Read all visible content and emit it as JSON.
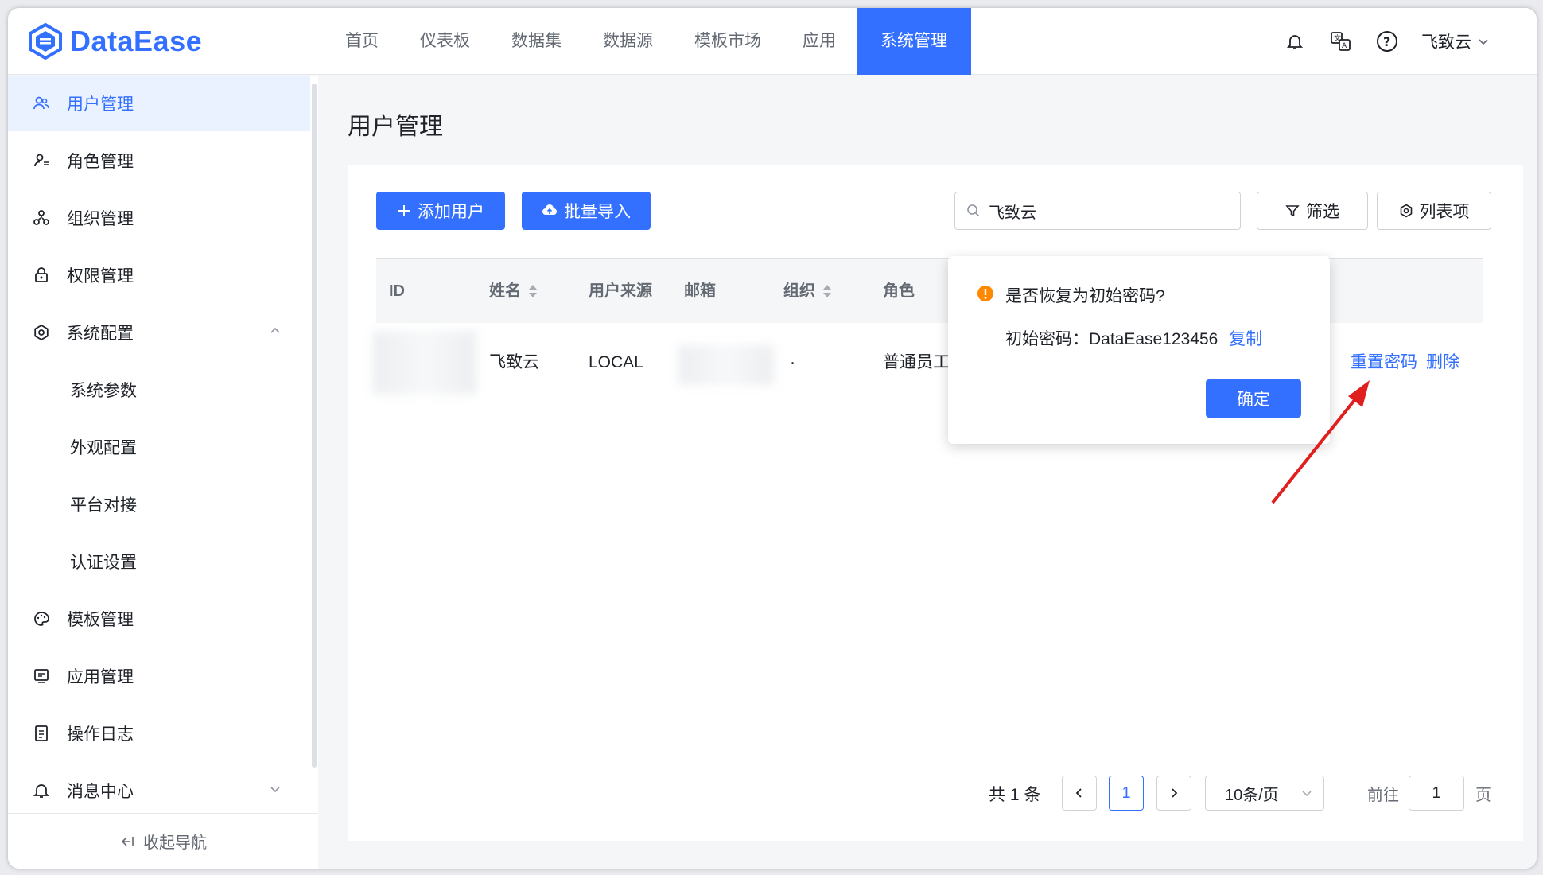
{
  "app": {
    "logo_text": "DataEase"
  },
  "nav": {
    "items": [
      "首页",
      "仪表板",
      "数据集",
      "数据源",
      "模板市场",
      "应用",
      "系统管理"
    ],
    "active_index": 6
  },
  "header": {
    "user_name": "飞致云"
  },
  "sidebar": {
    "items": [
      {
        "label": "用户管理",
        "icon": "users-icon"
      },
      {
        "label": "角色管理",
        "icon": "role-icon"
      },
      {
        "label": "组织管理",
        "icon": "org-icon"
      },
      {
        "label": "权限管理",
        "icon": "lock-icon"
      },
      {
        "label": "系统配置",
        "icon": "gear-icon"
      },
      {
        "label": "系统参数"
      },
      {
        "label": "外观配置"
      },
      {
        "label": "平台对接"
      },
      {
        "label": "认证设置"
      },
      {
        "label": "模板管理",
        "icon": "palette-icon"
      },
      {
        "label": "应用管理",
        "icon": "app-icon"
      },
      {
        "label": "操作日志",
        "icon": "log-icon"
      },
      {
        "label": "消息中心",
        "icon": "bell-icon"
      }
    ],
    "collapse_label": "收起导航"
  },
  "page": {
    "title": "用户管理"
  },
  "toolbar": {
    "add_user": "添加用户",
    "batch_import": "批量导入",
    "search_value": "飞致云",
    "filter": "筛选",
    "columns": "列表项"
  },
  "table": {
    "headers": [
      "ID",
      "姓名",
      "用户来源",
      "邮箱",
      "组织",
      "角色"
    ],
    "row": {
      "name": "飞致云",
      "source": "LOCAL",
      "org": "·",
      "role": "普通员工",
      "actions": {
        "reset": "重置密码",
        "delete": "删除"
      }
    }
  },
  "popconfirm": {
    "title": "是否恢复为初始密码?",
    "body_label": "初始密码：DataEase123456",
    "copy": "复制",
    "confirm": "确定"
  },
  "pagination": {
    "total": "共 1 条",
    "current": "1",
    "page_size": "10条/页",
    "goto_label": "前往",
    "goto_value": "1",
    "page_suffix": "页"
  },
  "colors": {
    "primary": "#3370ff",
    "warning": "#ff8800",
    "annotation": "#e01f1f"
  }
}
